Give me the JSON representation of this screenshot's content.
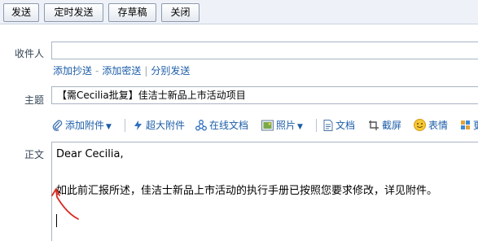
{
  "toolbar": {
    "send": "发送",
    "schedule_send": "定时发送",
    "save_draft": "存草稿",
    "close": "关闭"
  },
  "compose": {
    "to_label": "收件人",
    "to_value": "",
    "links": {
      "add_cc": "添加抄送",
      "add_bcc": "添加密送",
      "separate_send": "分别发送",
      "separator": "-",
      "separator2": "|"
    },
    "subject_label": "主题",
    "subject_value": "【需Cecilia批复】佳洁士新品上市活动项目",
    "body_label": "正文",
    "body": {
      "greeting": "Dear Cecilia,",
      "text": "如此前汇报所述，佳洁士新品上市活动的执行手册已按照您要求修改，详见附件。"
    }
  },
  "editor_toolbar": {
    "add_attachment": "添加附件",
    "big_attachment": "超大附件",
    "online_doc": "在线文档",
    "photo": "照片",
    "document": "文档",
    "screenshot": "截屏",
    "emoji": "表情",
    "more": "更"
  },
  "colors": {
    "link": "#1d5ea8",
    "annotation": "#d8281e",
    "toolbar_bg": "#eef2f8"
  }
}
